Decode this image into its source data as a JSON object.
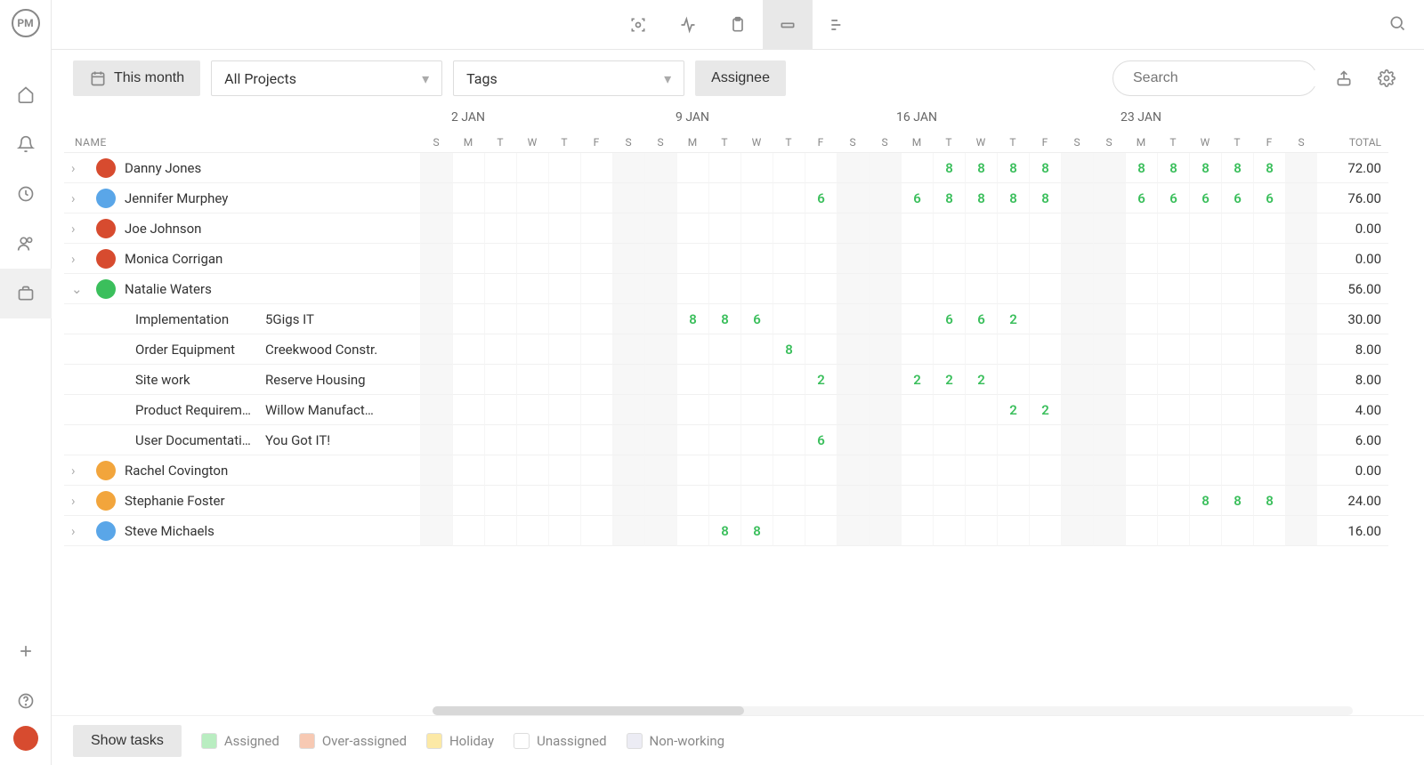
{
  "sidebar": {
    "logo": "PM"
  },
  "filters": {
    "range_label": "This month",
    "projects_label": "All Projects",
    "tags_label": "Tags",
    "assignee_label": "Assignee",
    "search_placeholder": "Search"
  },
  "columns": {
    "name_header": "NAME",
    "total_header": "TOTAL",
    "weeks": [
      {
        "label": "2 JAN",
        "start_index": 1
      },
      {
        "label": "9 JAN",
        "start_index": 8
      },
      {
        "label": "16 JAN",
        "start_index": 15
      },
      {
        "label": "23 JAN",
        "start_index": 22
      }
    ],
    "day_letters": [
      "S",
      "M",
      "T",
      "W",
      "T",
      "F",
      "S",
      "S",
      "M",
      "T",
      "W",
      "T",
      "F",
      "S",
      "S",
      "M",
      "T",
      "W",
      "T",
      "F",
      "S",
      "S",
      "M",
      "T",
      "W",
      "T",
      "F",
      "S"
    ],
    "weekend_indices": [
      0,
      6,
      7,
      13,
      14,
      20,
      21,
      27
    ]
  },
  "rows": [
    {
      "type": "person",
      "expanded": false,
      "name": "Danny Jones",
      "avatar": "#d74b2f",
      "total": "72.00",
      "hours": {
        "16": "8",
        "17": "8",
        "18": "8",
        "19": "8",
        "22": "8",
        "23": "8",
        "24": "8",
        "25": "8",
        "26": "8"
      }
    },
    {
      "type": "person",
      "expanded": false,
      "name": "Jennifer Murphey",
      "avatar": "#5aa6e8",
      "total": "76.00",
      "hours": {
        "12": "6",
        "15": "6",
        "16": "8",
        "17": "8",
        "18": "8",
        "19": "8",
        "22": "6",
        "23": "6",
        "24": "6",
        "25": "6",
        "26": "6"
      }
    },
    {
      "type": "person",
      "expanded": false,
      "name": "Joe Johnson",
      "avatar": "#d74b2f",
      "total": "0.00",
      "hours": {}
    },
    {
      "type": "person",
      "expanded": false,
      "name": "Monica Corrigan",
      "avatar": "#d74b2f",
      "total": "0.00",
      "hours": {}
    },
    {
      "type": "person",
      "expanded": true,
      "name": "Natalie Waters",
      "avatar": "#3bbf5c",
      "total": "56.00",
      "hours": {}
    },
    {
      "type": "task",
      "task": "Implementation",
      "project": "5Gigs IT",
      "total": "30.00",
      "hours": {
        "8": "8",
        "9": "8",
        "10": "6",
        "16": "6",
        "17": "6",
        "18": "2"
      }
    },
    {
      "type": "task",
      "task": "Order Equipment",
      "project": "Creekwood Constr.",
      "total": "8.00",
      "hours": {
        "11": "8"
      }
    },
    {
      "type": "task",
      "task": "Site work",
      "project": "Reserve Housing",
      "total": "8.00",
      "hours": {
        "12": "2",
        "15": "2",
        "16": "2",
        "17": "2"
      }
    },
    {
      "type": "task",
      "task": "Product Requirem…",
      "project": "Willow Manufactur…",
      "total": "4.00",
      "hours": {
        "18": "2",
        "19": "2"
      }
    },
    {
      "type": "task",
      "task": "User Documentati…",
      "project": "You Got IT!",
      "total": "6.00",
      "hours": {
        "12": "6"
      }
    },
    {
      "type": "person",
      "expanded": false,
      "name": "Rachel Covington",
      "avatar": "#f2a53c",
      "total": "0.00",
      "hours": {}
    },
    {
      "type": "person",
      "expanded": false,
      "name": "Stephanie Foster",
      "avatar": "#f2a53c",
      "total": "24.00",
      "hours": {
        "24": "8",
        "25": "8",
        "26": "8"
      }
    },
    {
      "type": "person",
      "expanded": false,
      "name": "Steve Michaels",
      "avatar": "#5aa6e8",
      "total": "16.00",
      "hours": {
        "9": "8",
        "10": "8"
      }
    }
  ],
  "legend": {
    "button_label": "Show tasks",
    "items": [
      {
        "label": "Assigned",
        "color": "#b9edc1"
      },
      {
        "label": "Over-assigned",
        "color": "#f7c9b3"
      },
      {
        "label": "Holiday",
        "color": "#fce9a6"
      },
      {
        "label": "Unassigned",
        "color": "#ffffff"
      },
      {
        "label": "Non-working",
        "color": "#ececf4"
      }
    ]
  }
}
